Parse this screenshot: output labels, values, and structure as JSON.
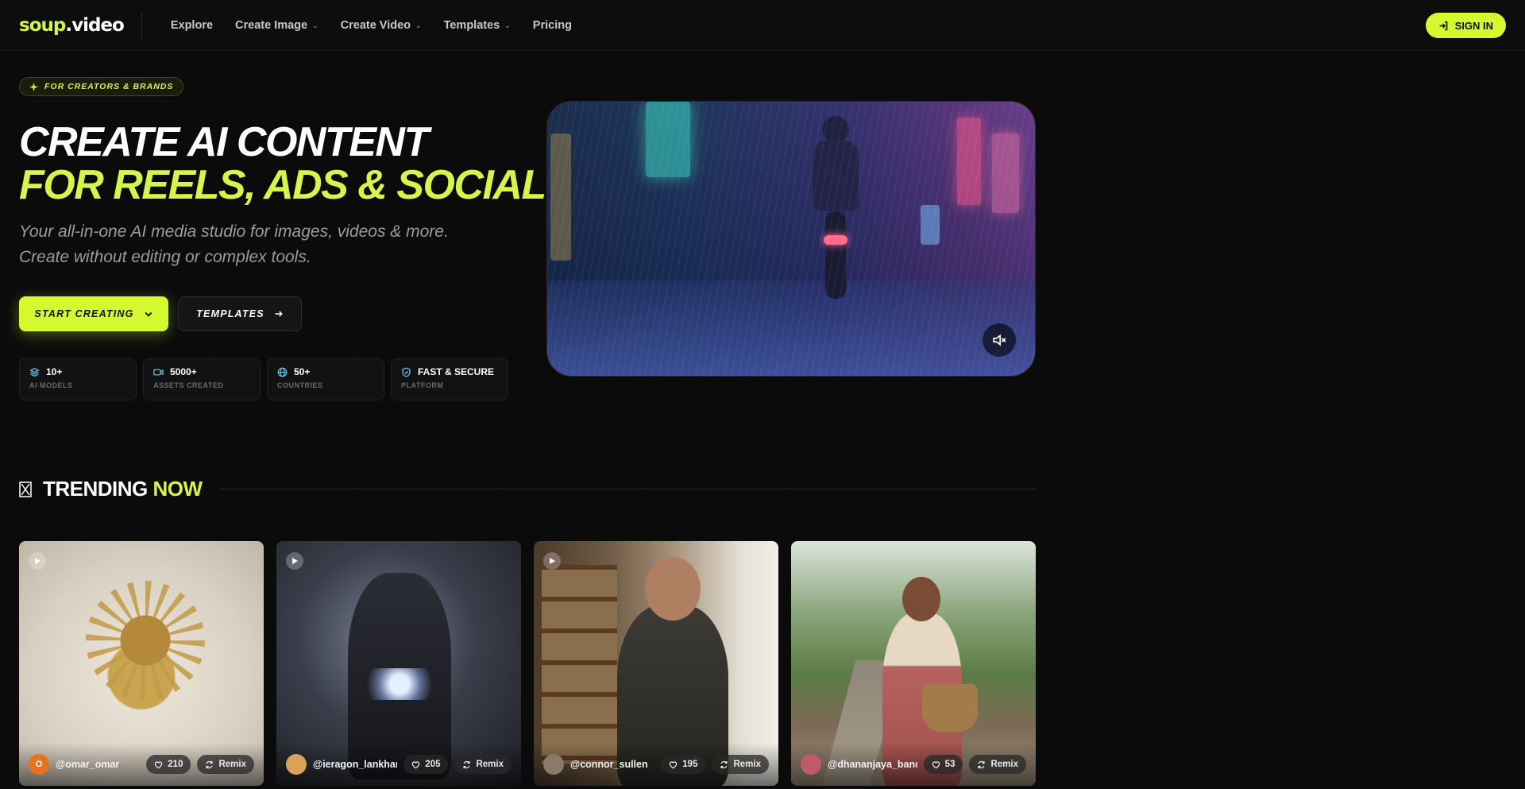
{
  "header": {
    "logo_part1": "soup",
    "logo_part2": ".video",
    "nav": [
      {
        "label": "Explore",
        "has_dropdown": false
      },
      {
        "label": "Create Image",
        "has_dropdown": true
      },
      {
        "label": "Create Video",
        "has_dropdown": true
      },
      {
        "label": "Templates",
        "has_dropdown": true
      },
      {
        "label": "Pricing",
        "has_dropdown": false
      }
    ],
    "signin_label": "SIGN IN"
  },
  "hero": {
    "badge": "FOR CREATORS & BRANDS",
    "title_line1": "CREATE AI CONTENT",
    "title_line2": "FOR REELS, ADS & SOCIAL",
    "subtitle_line1": "Your all-in-one AI media studio for images, videos & more.",
    "subtitle_line2": "Create without editing or complex tools.",
    "primary_button": "START CREATING",
    "secondary_button": "TEMPLATES",
    "stats": [
      {
        "value": "10+",
        "label": "AI MODELS",
        "icon": "layers-icon"
      },
      {
        "value": "5000+",
        "label": "ASSETS CREATED",
        "icon": "video-icon"
      },
      {
        "value": "50+",
        "label": "COUNTRIES",
        "icon": "globe-icon"
      },
      {
        "value": "FAST & SECURE",
        "label": "PLATFORM",
        "icon": "shield-icon"
      }
    ]
  },
  "colors": {
    "accent": "#d4f92e",
    "background": "#0b0b0c",
    "stat_icon": "#5fc3e8"
  },
  "trending": {
    "title_main": "TRENDING",
    "title_accent": "NOW",
    "cards": [
      {
        "handle": "@omar_omar",
        "likes": "210",
        "remix": "Remix",
        "avatar_initial": "O",
        "avatar_color": "#e8731f"
      },
      {
        "handle": "@ieragon_lankhar",
        "likes": "205",
        "remix": "Remix",
        "avatar_initial": "",
        "avatar_color": "#d9a25a"
      },
      {
        "handle": "@connor_sullen",
        "likes": "195",
        "remix": "Remix",
        "avatar_initial": "",
        "avatar_color": "#8a7a6a"
      },
      {
        "handle": "@dhananjaya_bandara",
        "likes": "53",
        "remix": "Remix",
        "avatar_initial": "",
        "avatar_color": "#c05a6a"
      }
    ]
  }
}
